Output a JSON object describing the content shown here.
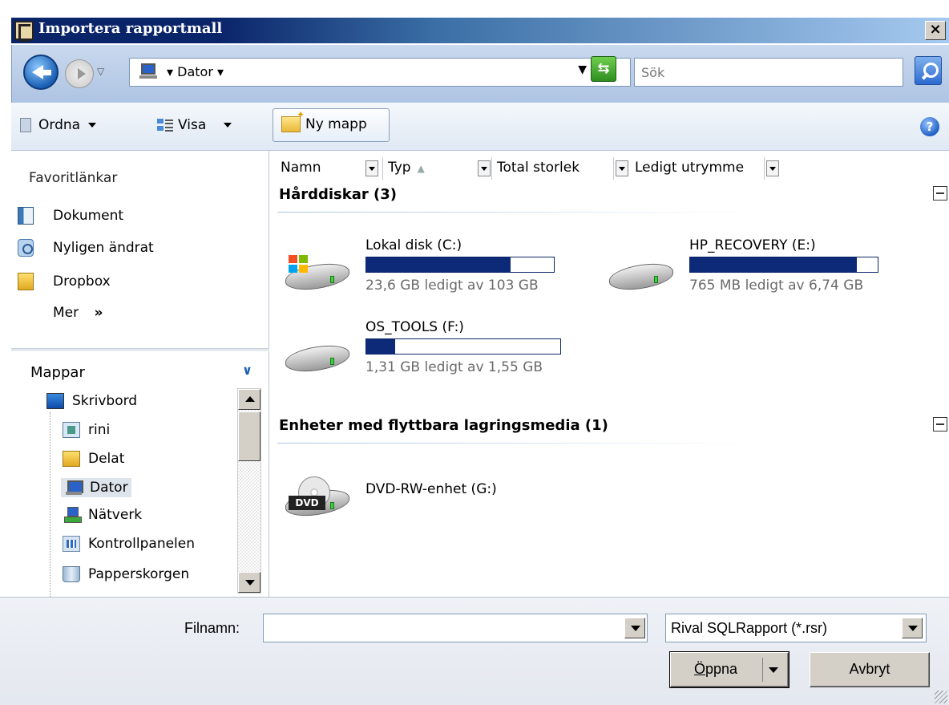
{
  "window": {
    "title": "Importera rapportmall",
    "close_label": "×"
  },
  "address": {
    "crumb": "Dator",
    "search_placeholder": "Sök"
  },
  "toolbar": {
    "ordna_label": "Ordna",
    "visa_label": "Visa",
    "new_folder_label": "Ny mapp",
    "help_label": "?"
  },
  "favorites": {
    "header": "Favoritlänkar",
    "items": [
      {
        "label": "Dokument"
      },
      {
        "label": "Nyligen ändrat"
      },
      {
        "label": "Dropbox"
      }
    ],
    "more_label": "Mer",
    "more_glyph": "»"
  },
  "folders": {
    "header": "Mappar",
    "items": [
      {
        "label": "Skrivbord"
      },
      {
        "label": "rini"
      },
      {
        "label": "Delat"
      },
      {
        "label": "Dator"
      },
      {
        "label": "Nätverk"
      },
      {
        "label": "Kontrollpanelen"
      },
      {
        "label": "Papperskorgen"
      }
    ]
  },
  "columns": [
    {
      "label": "Namn"
    },
    {
      "label": "Typ"
    },
    {
      "label": "Total storlek"
    },
    {
      "label": "Ledigt utrymme"
    }
  ],
  "groups": {
    "hard_disks": {
      "title": "Hårddiskar (3)"
    },
    "removable": {
      "title": "Enheter med flyttbara lagringsmedia (1)"
    }
  },
  "drives": [
    {
      "name": "Lokal disk (C:)",
      "free_text": "23,6 GB ledigt av 103 GB",
      "used_fraction": 0.77
    },
    {
      "name": "HP_RECOVERY (E:)",
      "free_text": "765 MB ledigt av 6,74 GB",
      "used_fraction": 0.89
    },
    {
      "name": "OS_TOOLS (F:)",
      "free_text": "1,31 GB ledigt av 1,55 GB",
      "used_fraction": 0.15
    }
  ],
  "removable_drives": [
    {
      "name": "DVD-RW-enhet (G:)",
      "badge": "DVD"
    }
  ],
  "bottom": {
    "filename_label": "Filnamn:",
    "filename_value": "",
    "filetype_value": "Rival SQLRapport (*.rsr)",
    "open_label": "Öppna",
    "cancel_label": "Avbryt"
  },
  "colors": {
    "title_bar": "#0a246a",
    "progress_fill": "#0c2a78"
  }
}
